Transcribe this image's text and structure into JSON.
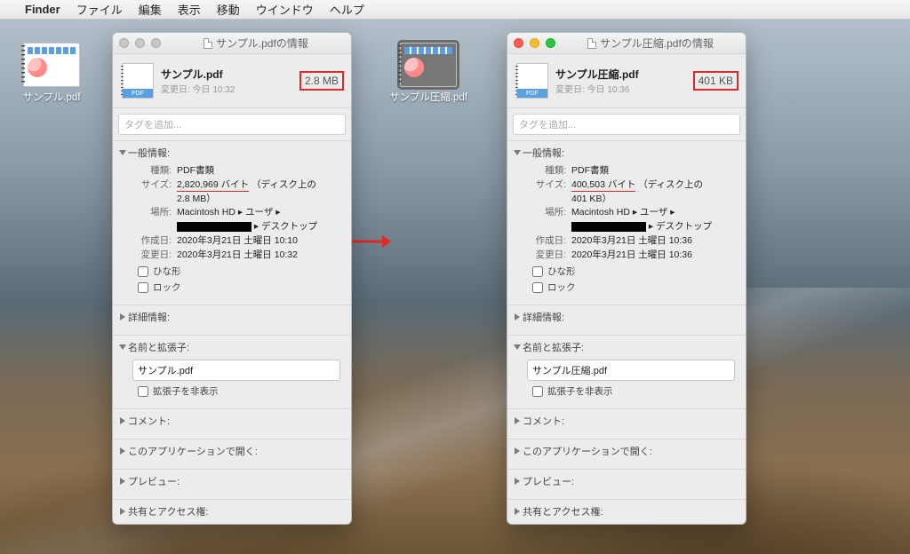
{
  "menubar": {
    "app": "Finder",
    "items": [
      "ファイル",
      "編集",
      "表示",
      "移動",
      "ウインドウ",
      "ヘルプ"
    ]
  },
  "desktop": {
    "icon1_label": "サンプル.pdf",
    "icon2_label": "サンプル圧縮.pdf"
  },
  "arrow_color": "#e02a2a",
  "panel_left": {
    "title": "サンプル.pdfの情報",
    "filename": "サンプル.pdf",
    "modified_short": "変更日: 今日 10:32",
    "size_box": "2.8 MB",
    "tag_placeholder": "タグを追加...",
    "general_label": "一般情報:",
    "kind_label": "種類:",
    "kind_value": "PDF書類",
    "size_label": "サイズ:",
    "size_value_main": "2,820,969 バイト",
    "size_value_tail": "（ディスク上の",
    "size_value_line2": "2.8 MB）",
    "where_label": "場所:",
    "where_value1": "Macintosh HD ▸ ユーザ ▸",
    "where_value2": " ▸ デスクトップ",
    "created_label": "作成日:",
    "created_value": "2020年3月21日 土曜日 10:10",
    "modified_label": "変更日:",
    "modified_value": "2020年3月21日 土曜日 10:32",
    "stationery_label": "ひな形",
    "locked_label": "ロック",
    "more_info_label": "詳細情報:",
    "name_ext_label": "名前と拡張子:",
    "name_ext_value": "サンプル.pdf",
    "hide_ext_label": "拡張子を非表示",
    "comment_label": "コメント:",
    "openwith_label": "このアプリケーションで開く:",
    "preview_label": "プレビュー:",
    "sharing_label": "共有とアクセス権:"
  },
  "panel_right": {
    "title": "サンプル圧縮.pdfの情報",
    "filename": "サンプル圧縮.pdf",
    "modified_short": "変更日: 今日 10:36",
    "size_box": "401 KB",
    "tag_placeholder": "タグを追加...",
    "general_label": "一般情報:",
    "kind_label": "種類:",
    "kind_value": "PDF書類",
    "size_label": "サイズ:",
    "size_value_main": "400,503 バイト",
    "size_value_tail": "（ディスク上の",
    "size_value_line2": "401 KB）",
    "where_label": "場所:",
    "where_value1": "Macintosh HD ▸ ユーザ ▸",
    "where_value2": " ▸ デスクトップ",
    "created_label": "作成日:",
    "created_value": "2020年3月21日 土曜日 10:36",
    "modified_label": "変更日:",
    "modified_value": "2020年3月21日 土曜日 10:36",
    "stationery_label": "ひな形",
    "locked_label": "ロック",
    "more_info_label": "詳細情報:",
    "name_ext_label": "名前と拡張子:",
    "name_ext_value": "サンプル圧縮.pdf",
    "hide_ext_label": "拡張子を非表示",
    "comment_label": "コメント:",
    "openwith_label": "このアプリケーションで開く:",
    "preview_label": "プレビュー:",
    "sharing_label": "共有とアクセス権:"
  }
}
